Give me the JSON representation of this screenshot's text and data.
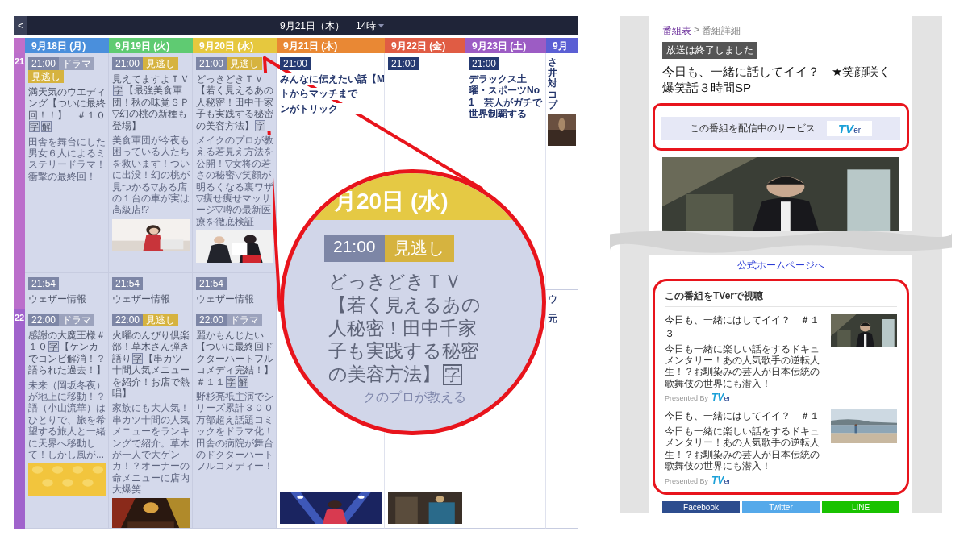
{
  "schedule": {
    "back_button": "<",
    "date": "9月21日（木）",
    "hour_menu": "14時",
    "days": [
      {
        "label": "9月18日 (月)",
        "color": "#4a8fdc"
      },
      {
        "label": "9月19日 (火)",
        "color": "#5fcb72"
      },
      {
        "label": "9月20日 (水)",
        "color": "#e6c83e"
      },
      {
        "label": "9月21日 (木)",
        "color": "#e98834"
      },
      {
        "label": "9月22日 (金)",
        "color": "#e05c44"
      },
      {
        "label": "9月23日 (土)",
        "color": "#9c5cc4"
      },
      {
        "label": "9月",
        "color": "#5b5fd4"
      }
    ],
    "hours": [
      {
        "label": "21",
        "cells": [
          {
            "past": true,
            "programs": [
              {
                "badges": [
                  {
                    "kind": "time",
                    "text": "21:00"
                  },
                  {
                    "kind": "genre",
                    "text": "ドラマ"
                  },
                  {
                    "kind": "catchup",
                    "text": "見逃し"
                  }
                ],
                "title": [
                  {
                    "kind": "text",
                    "text": "満天気のウエディング【ついに最終回！！】　＃１０"
                  },
                  {
                    "kind": "mark",
                    "text": "字"
                  },
                  {
                    "kind": "mark",
                    "text": "解"
                  }
                ],
                "description": "田舎を舞台にした男女６人によるミステリードラマ！衝撃の最終回！"
              },
              {
                "badges": [
                  {
                    "kind": "time",
                    "text": "21:54"
                  }
                ],
                "title": [
                  {
                    "kind": "text",
                    "text": "ウェザー情報"
                  }
                ]
              }
            ]
          },
          {
            "past": true,
            "programs": [
              {
                "badges": [
                  {
                    "kind": "time",
                    "text": "21:00"
                  },
                  {
                    "kind": "catchup",
                    "text": "見逃し"
                  }
                ],
                "title": [
                  {
                    "kind": "text",
                    "text": "見えてますよＴＶ"
                  },
                  {
                    "kind": "mark",
                    "text": "字"
                  },
                  {
                    "kind": "text",
                    "text": "【最強美食軍団！秋の味覚ＳＰ▽幻の桃の新種も登場】"
                  }
                ],
                "description": "美食軍団が今夜も困っている人たちを救います！ついに出没！幻の桃が見つかる▽ある店の１台の車が実は高級店!?",
                "picture": {
                  "kind": "picture"
                }
              },
              {
                "badges": [
                  {
                    "kind": "time",
                    "text": "21:54"
                  }
                ],
                "title": [
                  {
                    "kind": "text",
                    "text": "ウェザー情報"
                  }
                ]
              }
            ]
          },
          {
            "past": true,
            "programs": [
              {
                "badges": [
                  {
                    "kind": "time",
                    "text": "21:00"
                  },
                  {
                    "kind": "catchup",
                    "text": "見逃し"
                  }
                ],
                "title": [
                  {
                    "kind": "text",
                    "text": "どっきどきＴＶ【若く見えるあの人秘密！田中千家子も実践する秘密の美容方法】"
                  },
                  {
                    "kind": "mark",
                    "text": "字"
                  }
                ],
                "description": "メイクのプロが教える若見え方法を公開！▽女将の若さの秘密▽笑顔が明るくなる裏ワザ▽痩せ痩せマッサージ▽噂の最新医療を徹底検証",
                "picture": {
                  "kind": "picture"
                }
              },
              {
                "badges": [
                  {
                    "kind": "time",
                    "text": "21:54"
                  }
                ],
                "title": [
                  {
                    "kind": "text",
                    "text": "ウェザー情報"
                  }
                ]
              }
            ]
          },
          {
            "past": false,
            "programs": [
              {
                "badges": [
                  {
                    "kind": "time",
                    "text": "21:00"
                  }
                ],
                "title_lines": [
                  "みんなに伝えたい話【M",
                  "トからマッチまで",
                  "ンがトリック"
                ]
              }
            ]
          },
          {
            "past": false,
            "programs": [
              {
                "badges": [
                  {
                    "kind": "time",
                    "text": "21:00"
                  }
                ]
              }
            ]
          },
          {
            "past": false,
            "programs": [
              {
                "badges": [
                  {
                    "kind": "time",
                    "text": "21:00"
                  }
                ],
                "title": [
                  {
                    "kind": "text",
                    "text": "デラックス土曜・スポーツNo1　芸人がガチで世界制覇する"
                  }
                ]
              }
            ]
          },
          {
            "past": false,
            "programs": [
              {
                "title": [
                  {
                    "kind": "text",
                    "text": "さ井対コプ"
                  }
                ],
                "picture": {
                  "kind": "picture"
                }
              },
              {
                "title": [
                  {
                    "kind": "text",
                    "text": "ウ"
                  }
                ]
              }
            ]
          }
        ]
      },
      {
        "label": "22",
        "cells": [
          {
            "past": true,
            "programs": [
              {
                "badges": [
                  {
                    "kind": "time",
                    "text": "22:00"
                  },
                  {
                    "kind": "genre",
                    "text": "ドラマ"
                  }
                ],
                "title": [
                  {
                    "kind": "text",
                    "text": "感謝の大魔王様＃１０"
                  },
                  {
                    "kind": "mark",
                    "text": "字"
                  },
                  {
                    "kind": "text",
                    "text": "【ケンカでコンビ解消！？語られた過去！】"
                  }
                ],
                "description": "未来（岡坂冬夜）が地上に移動！？語（小山流華）はひとりで、旅を希望する旅人と一緒に天界へ移動して！しかし風が...",
                "picture": {
                  "kind": "picture"
                }
              }
            ]
          },
          {
            "past": true,
            "programs": [
              {
                "badges": [
                  {
                    "kind": "time",
                    "text": "22:00"
                  },
                  {
                    "kind": "catchup",
                    "text": "見逃し"
                  }
                ],
                "title": [
                  {
                    "kind": "text",
                    "text": "火曜のんびり倶楽部！草木さん弾き語り"
                  },
                  {
                    "kind": "mark",
                    "text": "字"
                  },
                  {
                    "kind": "text",
                    "text": "【串カツ十間人気メニューを紹介！お店で熱唱】"
                  }
                ],
                "description": "家族にも大人気！串カツ十間の人気メニューをランキングで紹介。草木が一人で大ゲンカ！？オーナーの命メニューに店内大爆笑",
                "picture": {
                  "kind": "picture"
                }
              }
            ]
          },
          {
            "past": true,
            "programs": [
              {
                "badges": [
                  {
                    "kind": "time",
                    "text": "22:00"
                  },
                  {
                    "kind": "genre",
                    "text": "ドラマ"
                  }
                ],
                "title": [
                  {
                    "kind": "text",
                    "text": "麗かもんじたい【ついに最終回ドクターハートフルコメディ完結！】＃１１"
                  },
                  {
                    "kind": "mark",
                    "text": "字"
                  },
                  {
                    "kind": "mark",
                    "text": "解"
                  }
                ],
                "description": "野杉亮祇主演でシリーズ累計３００万部超え話題コミックをドラマ化！田舎の病院が舞台のドクターハートフルコメディー！"
              }
            ]
          },
          {
            "past": false,
            "programs": [
              {
                "picture": {
                  "kind": "picture"
                }
              }
            ]
          },
          {
            "past": false,
            "programs": [
              {
                "picture": {
                  "kind": "picture"
                }
              }
            ]
          },
          {
            "past": false
          },
          {
            "past": false,
            "programs": [
              {
                "title": [
                  {
                    "kind": "text",
                    "text": "元"
                  }
                ]
              }
            ]
          }
        ]
      }
    ]
  },
  "magnifier": {
    "day_label": "月20日 (水)",
    "badges": [
      {
        "kind": "time",
        "text": "21:00"
      },
      {
        "kind": "catchup",
        "text": "見逃し"
      }
    ],
    "title": [
      {
        "kind": "text",
        "text": "どっきどきＴＶ【若く見えるあの人秘密！田中千家子も実践する秘密の美容方法】"
      },
      {
        "kind": "mark",
        "text": "字"
      }
    ],
    "description_fragment": "クのプロが教える"
  },
  "detail": {
    "breadcrumb": [
      {
        "text": "番組表",
        "link": true
      },
      {
        "text": ">",
        "link": false
      },
      {
        "text": "番組詳細",
        "link": false
      }
    ],
    "status_badge": "放送は終了しました",
    "title": "今日も、一緒に話してイイ？　★笑顔咲く爆笑話３時間SP",
    "service_banner": {
      "label": "この番組を配信中のサービス",
      "logo": {
        "main": "TV",
        "sub": "er"
      }
    },
    "hero": {
      "kind": "picture"
    },
    "homepage_link": "公式ホームページへ",
    "tver_section": {
      "heading": "この番組をTVerで視聴",
      "items": [
        {
          "title": "今日も、一緒にはしてイイ？　＃１３",
          "description": "今日も一緒に楽しい話をするドキュメンタリー！あの人気歌手の逆転人生！？お馴染みの芸人が日本伝統の歌舞伎の世界にも潜入！",
          "presented_by": "Presented By",
          "logo": {
            "main": "TV",
            "sub": "er"
          },
          "picture": {
            "kind": "picture"
          }
        },
        {
          "title": "今日も、一緒にはしてイイ？　＃１",
          "description": "今日も一緒に楽しい話をするドキュメンタリー！あの人気歌手の逆転人生！？お馴染みの芸人が日本伝統の歌舞伎の世界にも潜入！",
          "presented_by": "Presented By",
          "logo": {
            "main": "TV",
            "sub": "er"
          },
          "picture": {
            "kind": "picture"
          }
        }
      ]
    },
    "share_buttons": [
      {
        "label": "Facebook",
        "color": "#2d4d8e"
      },
      {
        "label": "Twitter",
        "color": "#55a9ea"
      },
      {
        "label": "LINE",
        "color": "#19c200"
      }
    ]
  }
}
